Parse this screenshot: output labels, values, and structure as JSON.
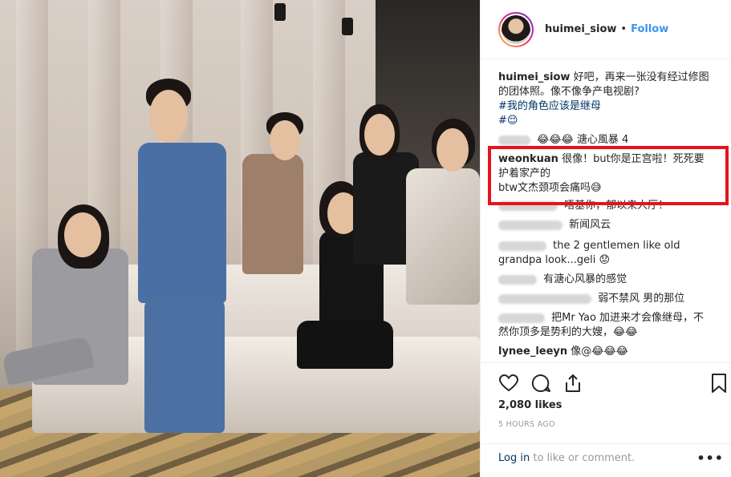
{
  "post": {
    "username": "huimei_siow",
    "separator": "•",
    "follow_label": "Follow"
  },
  "caption": {
    "username": "huimei_siow",
    "text1": "好吧，再来一张没有经过修图",
    "text2": "的团体照。像不像争产电视剧?",
    "hashtag1": "#我的角色应该是继母",
    "hashtag2": "#😌"
  },
  "comments": [
    {
      "user_hidden": true,
      "text": "😂😂😂 溏心風暴 4"
    },
    {
      "user": "weonkuan",
      "text1": "很像！but你是正宫啦！死死要",
      "text2": "护着家产的",
      "text3": "btw文杰颈项会痛吗😅"
    },
    {
      "user_hidden": true,
      "text": "唔基你，郁以来人厅！"
    },
    {
      "user_hidden": true,
      "text": "新闻风云"
    },
    {
      "user_hidden": true,
      "text1": "the 2 gentlemen like old",
      "text2": "grandpa look...geli 😟"
    },
    {
      "user_hidden": true,
      "text": "有溏心风暴的感觉"
    },
    {
      "user_hidden": true,
      "text": "弱不禁风 男的那位"
    },
    {
      "user_hidden": true,
      "text1": "把Mr Yao 加进来才会像继母，不",
      "text2": "然你顶多是势利的大嫂，😂😂"
    },
    {
      "user": "lynee_leeyn",
      "text": "像@😂😂😂"
    }
  ],
  "actions": {
    "like_icon": "heart-icon",
    "comment_icon": "comment-icon",
    "share_icon": "share-icon",
    "save_icon": "bookmark-icon"
  },
  "likes": "2,080 likes",
  "time_ago": "5 HOURS AGO",
  "footer": {
    "login": "Log in",
    "rest": "to like or comment.",
    "more": "•••"
  },
  "colors": {
    "link": "#3897f0",
    "hashtag": "#003569",
    "highlight": "#e3141c"
  }
}
